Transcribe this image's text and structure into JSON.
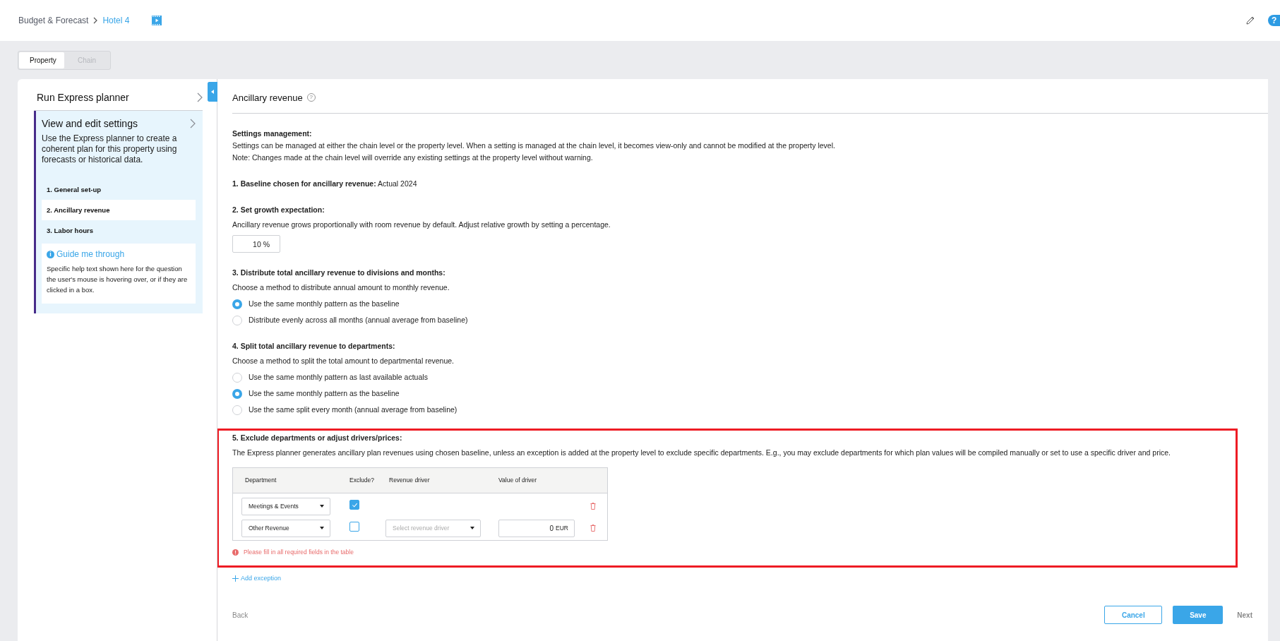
{
  "breadcrumb": [
    {
      "label": "Budget & Forecast",
      "current": false
    },
    {
      "label": "Hotel 4",
      "current": true
    }
  ],
  "header_actions": {
    "help_glyph": "?"
  },
  "scope_tabs": [
    {
      "label": "Property",
      "selected": true
    },
    {
      "label": "Chain",
      "selected": false
    }
  ],
  "sidebar": {
    "title": "Run Express planner",
    "section": {
      "title": "View and edit settings",
      "description": "Use the Express planner to create a coherent plan for this property using forecasts or historical data.",
      "steps": [
        {
          "label": "1. General set-up",
          "selected": false
        },
        {
          "label": "2. Ancillary revenue",
          "selected": true
        },
        {
          "label": "3. Labor hours",
          "selected": false
        }
      ],
      "guide": {
        "title": "Guide me through",
        "glyph": "i",
        "text": "Specific help text shown here for the question the user's mouse is hovering over, or if they are clicked in a box."
      }
    }
  },
  "main": {
    "title": "Ancillary revenue",
    "title_help_glyph": "?",
    "settings_management": {
      "heading": "Settings management:",
      "lines": [
        "Settings can be managed at either the chain level or the property level. When a setting is managed at the chain level, it becomes view-only and cannot be modified at the property level.",
        "Note: Changes made at the chain level will override any existing settings at the property level without warning."
      ]
    },
    "sections": [
      {
        "kind": "text",
        "heading": "**1.  Baseline chosen for ancillary revenue:** Actual 2024",
        "highlighted": false
      },
      {
        "kind": "input",
        "heading": "2.  Set growth expectation:",
        "text": "Ancillary revenue grows proportionally with room revenue by default. Adjust relative growth by setting a percentage.",
        "value": "10 %",
        "highlighted": false
      },
      {
        "kind": "radio",
        "heading": "3.  Distribute total ancillary revenue to divisions and months:",
        "text": "Choose a method to distribute annual amount to monthly revenue.",
        "options": [
          {
            "label": "Use the same monthly pattern as the baseline",
            "selected": true
          },
          {
            "label": "Distribute evenly across all months (annual average from baseline)",
            "selected": false
          }
        ],
        "highlighted": false
      },
      {
        "kind": "radio",
        "heading": "4.  Split total ancillary revenue to departments:",
        "text": "Choose a method to split the total amount to departmental revenue.",
        "options": [
          {
            "label": "Use the same monthly pattern as last available actuals",
            "selected": false
          },
          {
            "label": "Use the same monthly pattern as the baseline",
            "selected": true
          },
          {
            "label": "Use the same split every month (annual average from baseline)",
            "selected": false
          }
        ],
        "highlighted": false
      },
      {
        "kind": "table",
        "heading": "5.  Exclude departments or adjust drivers/prices:",
        "text": "The Express planner generates ancillary plan revenues using chosen baseline, unless an exception is added at the property level to exclude specific departments. E.g., you may exclude departments for which plan values will be compiled manually or set to use a specific driver and price.",
        "columns": [
          "Department",
          "Exclude?",
          "Revenue driver",
          "Value of driver"
        ],
        "rows": [
          {
            "department": "Meetings & Events",
            "exclude": true
          },
          {
            "department": "Other Revenue",
            "exclude": false,
            "driver_placeholder": "Select revenue driver",
            "value": "0",
            "unit": "EUR"
          }
        ],
        "error": "Please fill in all required fields in the table",
        "highlighted": true
      }
    ],
    "add_exception": "Add exception"
  },
  "footer": {
    "back": "Back",
    "cancel": "Cancel",
    "save": "Save",
    "next": "Next"
  }
}
